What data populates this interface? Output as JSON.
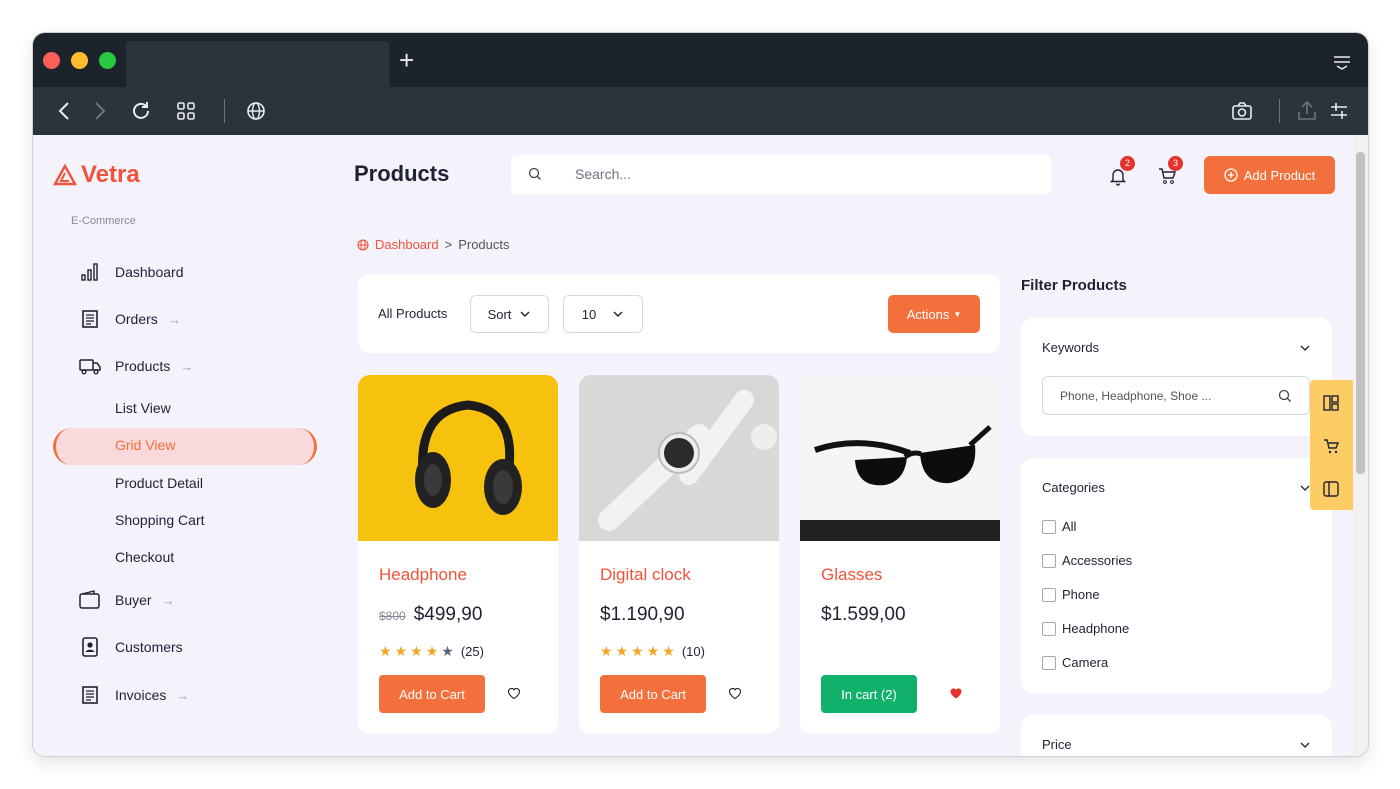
{
  "browser": {
    "traffic_lights": [
      "#fe5f57",
      "#febc2e",
      "#28c840"
    ],
    "new_tab_label": "+"
  },
  "sidebar": {
    "brand": "Vetra",
    "section": "E-Commerce",
    "nav": [
      {
        "label": "Dashboard",
        "arrow": ""
      },
      {
        "label": "Orders",
        "arrow": "→"
      },
      {
        "label": "Products",
        "arrow": "→"
      },
      {
        "label": "Buyer",
        "arrow": "→"
      },
      {
        "label": "Customers",
        "arrow": ""
      },
      {
        "label": "Invoices",
        "arrow": "→"
      }
    ],
    "products_sub": [
      "List View",
      "Grid View",
      "Product Detail",
      "Shopping Cart",
      "Checkout"
    ],
    "active_sub": "Grid View"
  },
  "header": {
    "title": "Products",
    "search_placeholder": "Search...",
    "notifications_count": "2",
    "cart_count": "3",
    "add_product_label": "Add Product"
  },
  "breadcrumb": {
    "root": "Dashboard",
    "separator": ">",
    "current": "Products"
  },
  "toolbar": {
    "all_products": "All Products",
    "sort_label": "Sort",
    "page_size": "10",
    "actions_label": "Actions"
  },
  "products": [
    {
      "name": "Headphone",
      "old_price": "$800",
      "price": "$499,90",
      "stars": 4,
      "reviews": "(25)",
      "button": "Add to Cart",
      "button_color": "#f36f3b",
      "favorite": false
    },
    {
      "name": "Digital clock",
      "old_price": "",
      "price": "$1.190,90",
      "stars": 5,
      "reviews": "(10)",
      "button": "Add to Cart",
      "button_color": "#f36f3b",
      "favorite": false
    },
    {
      "name": "Glasses",
      "old_price": "",
      "price": "$1.599,00",
      "stars": 0,
      "reviews": "",
      "button": "In cart (2)",
      "button_color": "#12b16b",
      "favorite": true
    }
  ],
  "filters": {
    "title": "Filter Products",
    "keywords_label": "Keywords",
    "keywords_placeholder": "Phone, Headphone, Shoe ...",
    "categories_label": "Categories",
    "categories": [
      "All",
      "Accessories",
      "Phone",
      "Headphone",
      "Camera"
    ],
    "price_label": "Price"
  },
  "colors": {
    "accent": "#f36f3b",
    "brand": "#f0533a",
    "success": "#12b16b"
  }
}
